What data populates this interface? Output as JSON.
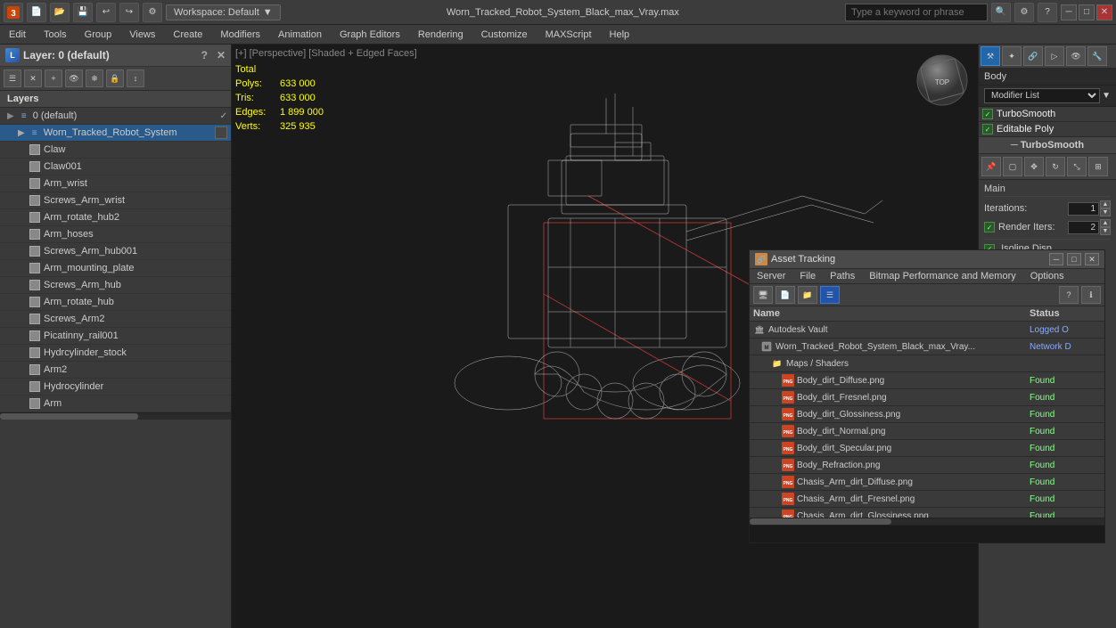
{
  "app": {
    "workspace_label": "Workspace: Default",
    "title": "Worn_Tracked_Robot_System_Black_max_Vray.max",
    "search_placeholder": "Type a keyword or phrase"
  },
  "menu": {
    "items": [
      "Edit",
      "Tools",
      "Group",
      "Views",
      "Create",
      "Modifiers",
      "Animation",
      "Graph Editors",
      "Rendering",
      "Customize",
      "MAXScript",
      "Help"
    ]
  },
  "viewport": {
    "label": "[+] [Perspective] [Shaded + Edged Faces]",
    "stats": {
      "polys_label": "Polys:",
      "polys_value": "633 000",
      "tris_label": "Tris:",
      "tris_value": "633 000",
      "edges_label": "Edges:",
      "edges_value": "1 899 000",
      "verts_label": "Verts:",
      "verts_value": "325 935",
      "total_label": "Total"
    }
  },
  "layers_panel": {
    "title": "Layer: 0 (default)",
    "section_label": "Layers",
    "items": [
      {
        "name": "0 (default)",
        "level": 0,
        "type": "layer",
        "checked": true
      },
      {
        "name": "Worn_Tracked_Robot_System",
        "level": 1,
        "type": "layer",
        "selected": true
      },
      {
        "name": "Claw",
        "level": 2,
        "type": "object"
      },
      {
        "name": "Claw001",
        "level": 2,
        "type": "object"
      },
      {
        "name": "Arm_wrist",
        "level": 2,
        "type": "object"
      },
      {
        "name": "Screws_Arm_wrist",
        "level": 2,
        "type": "object"
      },
      {
        "name": "Arm_rotate_hub2",
        "level": 2,
        "type": "object"
      },
      {
        "name": "Arm_hoses",
        "level": 2,
        "type": "object"
      },
      {
        "name": "Screws_Arm_hub001",
        "level": 2,
        "type": "object"
      },
      {
        "name": "Arm_mounting_plate",
        "level": 2,
        "type": "object"
      },
      {
        "name": "Screws_Arm_hub",
        "level": 2,
        "type": "object"
      },
      {
        "name": "Arm_rotate_hub",
        "level": 2,
        "type": "object"
      },
      {
        "name": "Screws_Arm2",
        "level": 2,
        "type": "object"
      },
      {
        "name": "Picatinny_rail001",
        "level": 2,
        "type": "object"
      },
      {
        "name": "Hydrcylinder_stock",
        "level": 2,
        "type": "object"
      },
      {
        "name": "Arm2",
        "level": 2,
        "type": "object"
      },
      {
        "name": "Hydrocylinder",
        "level": 2,
        "type": "object"
      },
      {
        "name": "Arm",
        "level": 2,
        "type": "object"
      }
    ]
  },
  "right_panel": {
    "body_label": "Body",
    "modifier_list_label": "Modifier List",
    "modifiers": [
      {
        "name": "TurboSmooth",
        "active": true
      },
      {
        "name": "Editable Poly",
        "active": true
      }
    ],
    "turbosmooth": {
      "header": "TurboSmooth",
      "main_label": "Main",
      "iterations_label": "Iterations:",
      "iterations_value": "1",
      "render_iters_label": "Render Iters:",
      "render_iters_value": "2"
    }
  },
  "asset_panel": {
    "title": "Asset Tracking",
    "menus": [
      "Server",
      "File",
      "Paths",
      "Bitmap Performance and Memory",
      "Options"
    ],
    "table": {
      "col_name": "Name",
      "col_status": "Status"
    },
    "items": [
      {
        "name": "Autodesk Vault",
        "status": "Logged O",
        "level": 0,
        "type": "vault"
      },
      {
        "name": "Worn_Tracked_Robot_System_Black_max_Vray...",
        "status": "Network D",
        "level": 1,
        "type": "file"
      },
      {
        "name": "Maps / Shaders",
        "status": "",
        "level": 2,
        "type": "folder"
      },
      {
        "name": "Body_dirt_Diffuse.png",
        "status": "Found",
        "level": 3,
        "type": "png"
      },
      {
        "name": "Body_dirt_Fresnel.png",
        "status": "Found",
        "level": 3,
        "type": "png"
      },
      {
        "name": "Body_dirt_Glossiness.png",
        "status": "Found",
        "level": 3,
        "type": "png"
      },
      {
        "name": "Body_dirt_Normal.png",
        "status": "Found",
        "level": 3,
        "type": "png"
      },
      {
        "name": "Body_dirt_Specular.png",
        "status": "Found",
        "level": 3,
        "type": "png"
      },
      {
        "name": "Body_Refraction.png",
        "status": "Found",
        "level": 3,
        "type": "png"
      },
      {
        "name": "Chasis_Arm_dirt_Diffuse.png",
        "status": "Found",
        "level": 3,
        "type": "png"
      },
      {
        "name": "Chasis_Arm_dirt_Fresnel.png",
        "status": "Found",
        "level": 3,
        "type": "png"
      },
      {
        "name": "Chasis_Arm_dirt_Glossiness.png",
        "status": "Found",
        "level": 3,
        "type": "png"
      }
    ]
  },
  "icons": {
    "layer": "☰",
    "close": "✕",
    "add": "+",
    "delete": "✕",
    "visibility": "👁",
    "lock": "🔒",
    "link": "🔗",
    "freeze": "❄",
    "color": "■",
    "search": "🔍",
    "question": "?",
    "minimize": "─",
    "maximize": "□",
    "pin": "📌",
    "move_pin": "↕",
    "folder": "📁",
    "png": "PNG",
    "vault": "🏛"
  }
}
